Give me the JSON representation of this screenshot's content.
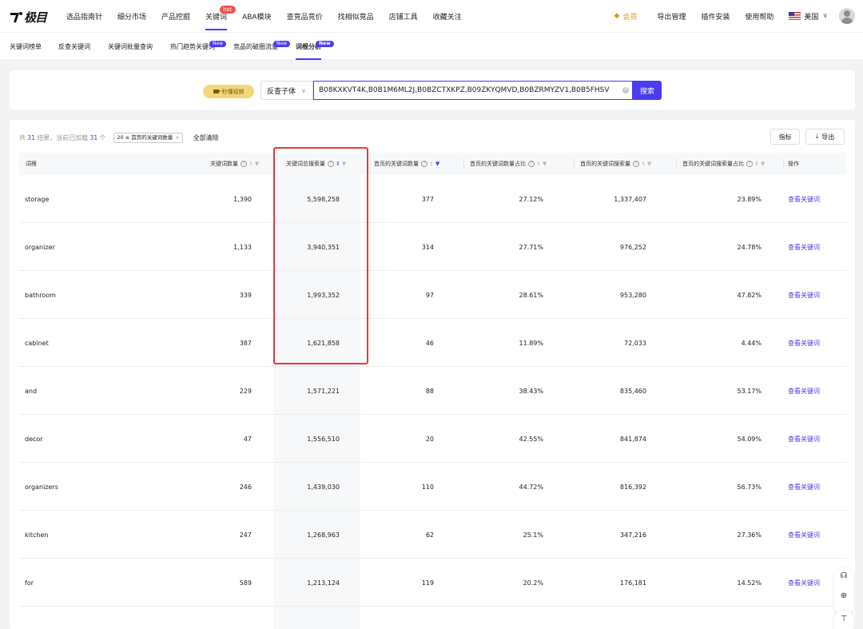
{
  "brand": {
    "logo_text": "极目"
  },
  "topnav": {
    "items": [
      {
        "label": "选品指南针"
      },
      {
        "label": "细分市场"
      },
      {
        "label": "产品挖掘"
      },
      {
        "label": "关键词"
      },
      {
        "label": "ABA模块"
      },
      {
        "label": "查竞品竞价"
      },
      {
        "label": "找相似竞品"
      },
      {
        "label": "店铺工具"
      },
      {
        "label": "收藏关注"
      }
    ],
    "hot_badge": "hot",
    "member": "会员",
    "export": "导出管理",
    "plugin": "插件安装",
    "help": "使用帮助",
    "region": "美国",
    "accent": "#4b3cf0"
  },
  "subnav": {
    "items": [
      {
        "label": "关键词榜单"
      },
      {
        "label": "反查关键词"
      },
      {
        "label": "关键词批量查询"
      },
      {
        "label": "热门趋势关键词",
        "badge": "New"
      },
      {
        "label": "竞品的破圈流量",
        "badge": "New"
      },
      {
        "label": "词根分析",
        "badge": "New"
      }
    ]
  },
  "search": {
    "video_label": "秒懂视频",
    "type_label": "反查子体",
    "query": "B08KXKVT4K,B0B1M6ML2J,B0BZCTXKPZ,B09ZKYQMVD,B0BZRMYZV1,B0B5FHSV",
    "button": "搜索"
  },
  "results": {
    "prefix": "共",
    "total": "31",
    "mid": "结果，当前已加载",
    "loaded": "31",
    "suffix": "个",
    "filter_tag": "20 ≤ 首页的关键词数量",
    "clear_all": "全部清除",
    "metric_btn": "指标",
    "export_btn": "导出"
  },
  "table": {
    "headers": {
      "root": "词根",
      "kw_count": "关键词数量",
      "total_search": "关键词总搜索量",
      "first_page_kw": "首页的关键词数量",
      "first_page_kw_pct": "首页的关键词数量占比",
      "first_page_search": "首页的关键词搜索量",
      "first_page_search_pct": "首页的关键词搜索量占比",
      "action": "操作"
    },
    "rows": [
      {
        "root": "storage",
        "kw_count": "1,390",
        "total_search": "5,598,258",
        "first_page_kw": "377",
        "first_page_kw_pct": "27.12%",
        "first_page_search": "1,337,407",
        "first_page_search_pct": "23.89%",
        "action": "查看关键词"
      },
      {
        "root": "organizer",
        "kw_count": "1,133",
        "total_search": "3,940,351",
        "first_page_kw": "314",
        "first_page_kw_pct": "27.71%",
        "first_page_search": "976,252",
        "first_page_search_pct": "24.78%",
        "action": "查看关键词"
      },
      {
        "root": "bathroom",
        "kw_count": "339",
        "total_search": "1,993,352",
        "first_page_kw": "97",
        "first_page_kw_pct": "28.61%",
        "first_page_search": "953,280",
        "first_page_search_pct": "47.82%",
        "action": "查看关键词"
      },
      {
        "root": "cabinet",
        "kw_count": "387",
        "total_search": "1,621,858",
        "first_page_kw": "46",
        "first_page_kw_pct": "11.89%",
        "first_page_search": "72,033",
        "first_page_search_pct": "4.44%",
        "action": "查看关键词"
      },
      {
        "root": "and",
        "kw_count": "229",
        "total_search": "1,571,221",
        "first_page_kw": "88",
        "first_page_kw_pct": "38.43%",
        "first_page_search": "835,460",
        "first_page_search_pct": "53.17%",
        "action": "查看关键词"
      },
      {
        "root": "decor",
        "kw_count": "47",
        "total_search": "1,556,510",
        "first_page_kw": "20",
        "first_page_kw_pct": "42.55%",
        "first_page_search": "841,874",
        "first_page_search_pct": "54.09%",
        "action": "查看关键词"
      },
      {
        "root": "organizers",
        "kw_count": "246",
        "total_search": "1,439,030",
        "first_page_kw": "110",
        "first_page_kw_pct": "44.72%",
        "first_page_search": "816,392",
        "first_page_search_pct": "56.73%",
        "action": "查看关键词"
      },
      {
        "root": "kitchen",
        "kw_count": "247",
        "total_search": "1,268,963",
        "first_page_kw": "62",
        "first_page_kw_pct": "25.1%",
        "first_page_search": "347,216",
        "first_page_search_pct": "27.36%",
        "action": "查看关键词"
      },
      {
        "root": "for",
        "kw_count": "589",
        "total_search": "1,213,124",
        "first_page_kw": "119",
        "first_page_kw_pct": "20.2%",
        "first_page_search": "176,181",
        "first_page_search_pct": "14.52%",
        "action": "查看关键词"
      }
    ]
  },
  "icons": {
    "logo": "logo-mark-icon",
    "member": "diamond-icon",
    "video": "video-camera-icon",
    "clear": "clear-icon",
    "export": "download-icon",
    "help": "question-icon",
    "sort": "sort-icon",
    "filter": "filter-icon",
    "headset": "headset-icon",
    "globe": "globe-icon",
    "top": "back-to-top-icon"
  }
}
